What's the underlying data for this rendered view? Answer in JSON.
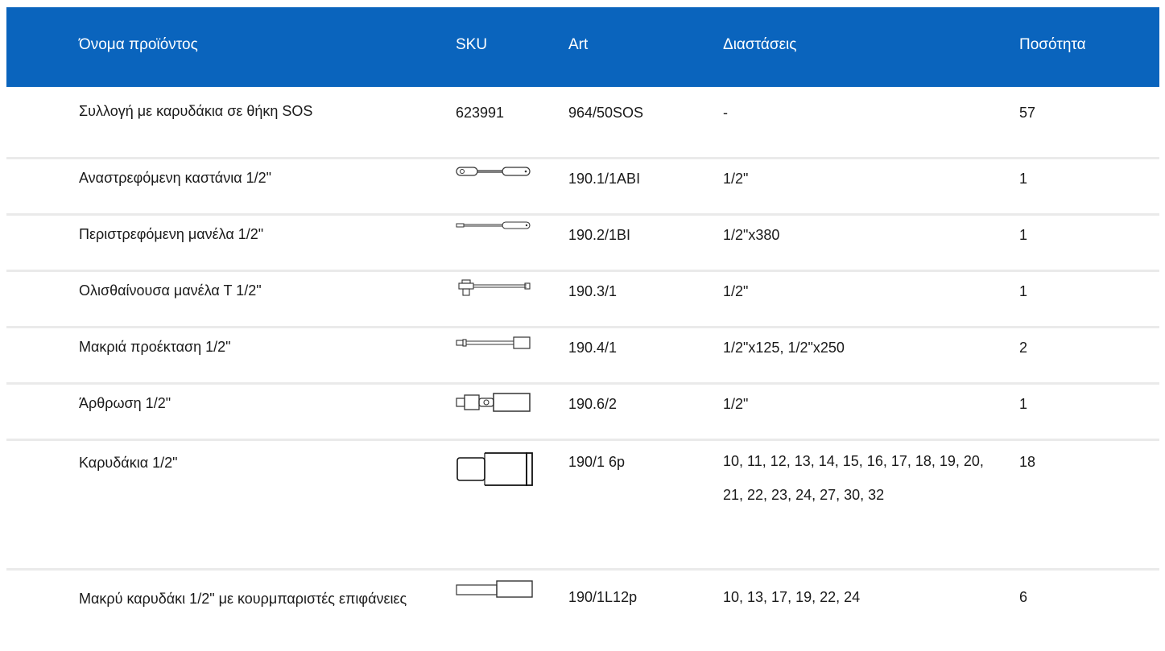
{
  "table": {
    "headers": {
      "name": "Όνομα προϊόντος",
      "sku": "SKU",
      "art": "Art",
      "dimensions": "Διαστάσεις",
      "quantity": "Ποσότητα"
    },
    "rows": [
      {
        "name": "Συλλογή με καρυδάκια σε θήκη SOS",
        "sku": "623991",
        "icon": null,
        "art": "964/50SOS",
        "dimensions": "-",
        "quantity": "57"
      },
      {
        "name": "Αναστρεφόμενη καστάνια 1/2\"",
        "sku": "",
        "icon": "ratchet-icon",
        "art": "190.1/1ABI",
        "dimensions": "1/2\"",
        "quantity": "1"
      },
      {
        "name": "Περιστρεφόμενη μανέλα 1/2\"",
        "sku": "",
        "icon": "swivel-handle-icon",
        "art": "190.2/1BI",
        "dimensions": "1/2\"x380",
        "quantity": "1"
      },
      {
        "name": "Ολισθαίνουσα μανέλα Τ 1/2\"",
        "sku": "",
        "icon": "sliding-t-handle-icon",
        "art": "190.3/1",
        "dimensions": "1/2\"",
        "quantity": "1"
      },
      {
        "name": "Μακριά προέκταση 1/2\"",
        "sku": "",
        "icon": "extension-bar-icon",
        "art": "190.4/1",
        "dimensions": "1/2\"x125, 1/2\"x250",
        "quantity": "2"
      },
      {
        "name": "Άρθρωση 1/2\"",
        "sku": "",
        "icon": "universal-joint-icon",
        "art": "190.6/2",
        "dimensions": "1/2\"",
        "quantity": "1"
      },
      {
        "name": "Καρυδάκια 1/2\"",
        "sku": "",
        "icon": "socket-icon",
        "art": "190/1 6p",
        "dimensions": "10, 11, 12, 13, 14, 15, 16, 17, 18, 19, 20, 21, 22, 23, 24, 27, 30, 32",
        "quantity": "18"
      },
      {
        "name": "Μακρύ καρυδάκι 1/2\" με κουρμπαριστές επιφάνειες",
        "sku": "",
        "icon": "deep-socket-icon",
        "art": "190/1L12p",
        "dimensions": "10, 13, 17, 19, 22, 24",
        "quantity": "6"
      }
    ]
  },
  "colors": {
    "header_bg": "#0a64bd",
    "header_text": "#ffffff",
    "row_divider": "#eaeaea"
  }
}
